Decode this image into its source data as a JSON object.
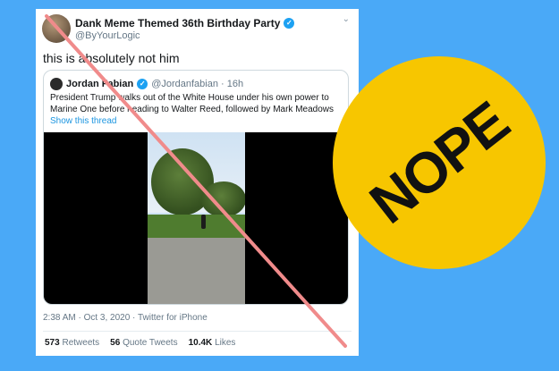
{
  "tweet": {
    "author_name": "Dank Meme Themed 36th Birthday Party",
    "handle": "@ByYourLogic",
    "text": "this is absolutely not him",
    "timestamp": "2:38 AM · Oct 3, 2020 · Twitter for iPhone",
    "stats": [
      {
        "count": "573",
        "label": "Retweets"
      },
      {
        "count": "56",
        "label": "Quote Tweets"
      },
      {
        "count": "10.4K",
        "label": "Likes"
      }
    ]
  },
  "quote": {
    "author_name": "Jordan Fabian",
    "handle_time": "@Jordanfabian · 16h",
    "text": "President Trump walks out of the White House under his own power to Marine One before heading to Walter Reed, followed by Mark Meadows",
    "link": "Show this thread"
  },
  "sticker": {
    "text": "NOPE"
  },
  "colors": {
    "background": "#4aa9f7",
    "sticker": "#f7c600",
    "slash": "#f08b8b",
    "verified": "#1da1f2"
  },
  "icons": [
    "verified-badge-icon",
    "chevron-down-icon"
  ]
}
